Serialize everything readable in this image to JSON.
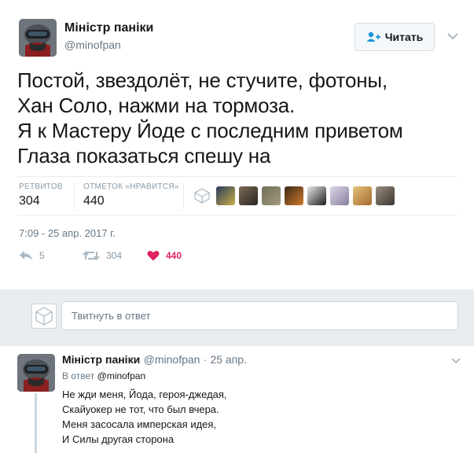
{
  "tweet": {
    "author": {
      "display_name": "Міністр паніки",
      "handle": "@minofpan"
    },
    "follow_button_label": "Читать",
    "text_lines": [
      "Постой, звездолёт, не стучите, фотоны,",
      "Хан Соло, нажми на тормоза.",
      "Я к Мастеру Йоде с последним приветом",
      "Глаза показаться спешу на"
    ],
    "stats": {
      "retweets_label": "РЕТВИТОВ",
      "retweets_value": "304",
      "likes_label": "ОТМЕТОК «НРАВИТСЯ»",
      "likes_value": "440"
    },
    "likers_count_shown": 9,
    "timestamp": "7:09 - 25 апр. 2017 г.",
    "actions": {
      "reply_count": "5",
      "retweet_count": "304",
      "like_count": "440"
    }
  },
  "reply_composer": {
    "placeholder": "Твитнуть в ответ"
  },
  "reply": {
    "display_name": "Міністр паніки",
    "handle": "@minofpan",
    "date": "· 25 апр.",
    "in_reply_to_prefix": "В ответ",
    "in_reply_to_handle": "@minofpan",
    "text_lines": [
      "Не жди меня, Йода, героя-джедая,",
      "Скайуокер не тот, что был вчера.",
      "Меня засосала имперская идея,",
      "И Силы другая сторона"
    ]
  },
  "colors": {
    "like_red": "#e0245e",
    "link_blue": "#1b95e0",
    "muted_gray": "#657786",
    "band_gray": "#e8edf2"
  }
}
